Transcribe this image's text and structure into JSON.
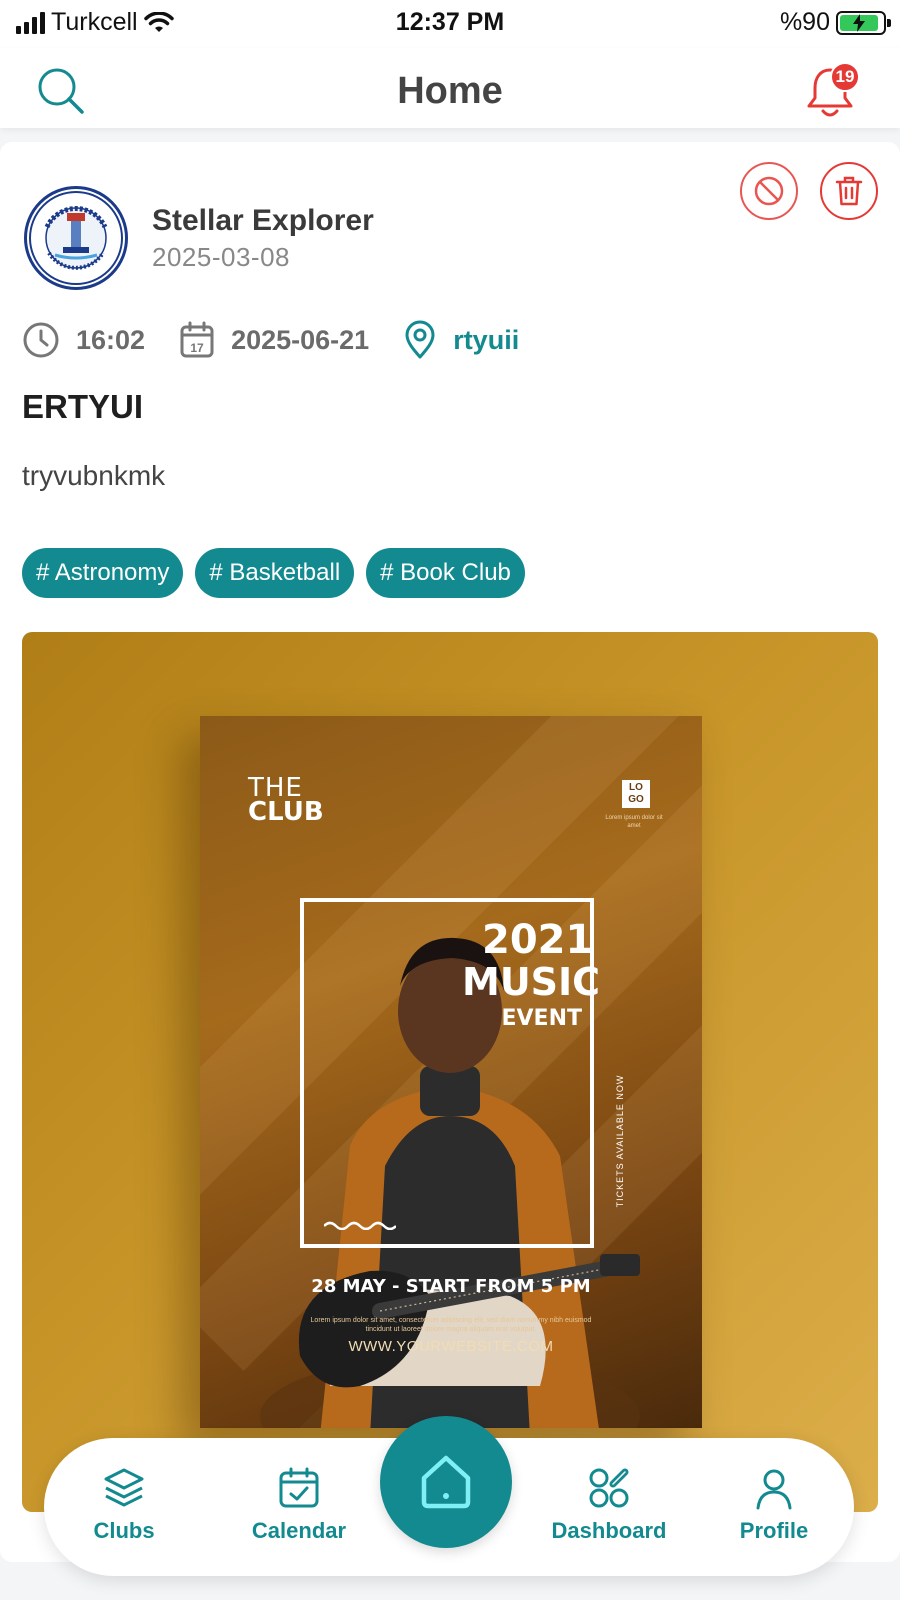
{
  "status_bar": {
    "carrier": "Turkcell",
    "time": "12:37 PM",
    "battery": "%90",
    "battery_level": 0.9
  },
  "header": {
    "title": "Home",
    "notification_count": "19"
  },
  "post": {
    "author": "Stellar Explorer",
    "posted_date": "2025-03-08",
    "event_time": "16:02",
    "event_date": "2025-06-21",
    "calendar_icon_day": "17",
    "location": "rtyuii",
    "title": "ERTYUI",
    "description": "tryvubnkmk",
    "tags": [
      "# Astronomy",
      "# Basketball",
      "# Book Club"
    ],
    "poster": {
      "club_line1": "THE",
      "club_line2": "CLUB",
      "logo_line1": "LO",
      "logo_line2": "GO",
      "logo_caption": "Lorem ipsum dolor sit amet",
      "year": "2021",
      "headline": "MUSIC",
      "subheadline": "EVENT",
      "side_text": "TICKETS AVAILABLE NOW",
      "date_line": "28 MAY - START FROM 5 PM",
      "lorem": "Lorem ipsum dolor sit amet, consectetuer adipiscing elit, sed diam nonummy nibh euismod tincidunt ut laoreet dolore magna aliquam erat volutpat.",
      "url": "WWW.YOURWEBSITE.COM"
    }
  },
  "nav": {
    "items": [
      {
        "label": "Clubs",
        "icon": "layers-icon"
      },
      {
        "label": "Calendar",
        "icon": "calendar-check-icon"
      },
      {
        "label": "Home",
        "icon": "home-icon"
      },
      {
        "label": "Dashboard",
        "icon": "dashboard-icon"
      },
      {
        "label": "Profile",
        "icon": "user-icon"
      }
    ]
  },
  "colors": {
    "accent": "#138a90",
    "danger": "#e53935",
    "badge": "#e53935"
  }
}
